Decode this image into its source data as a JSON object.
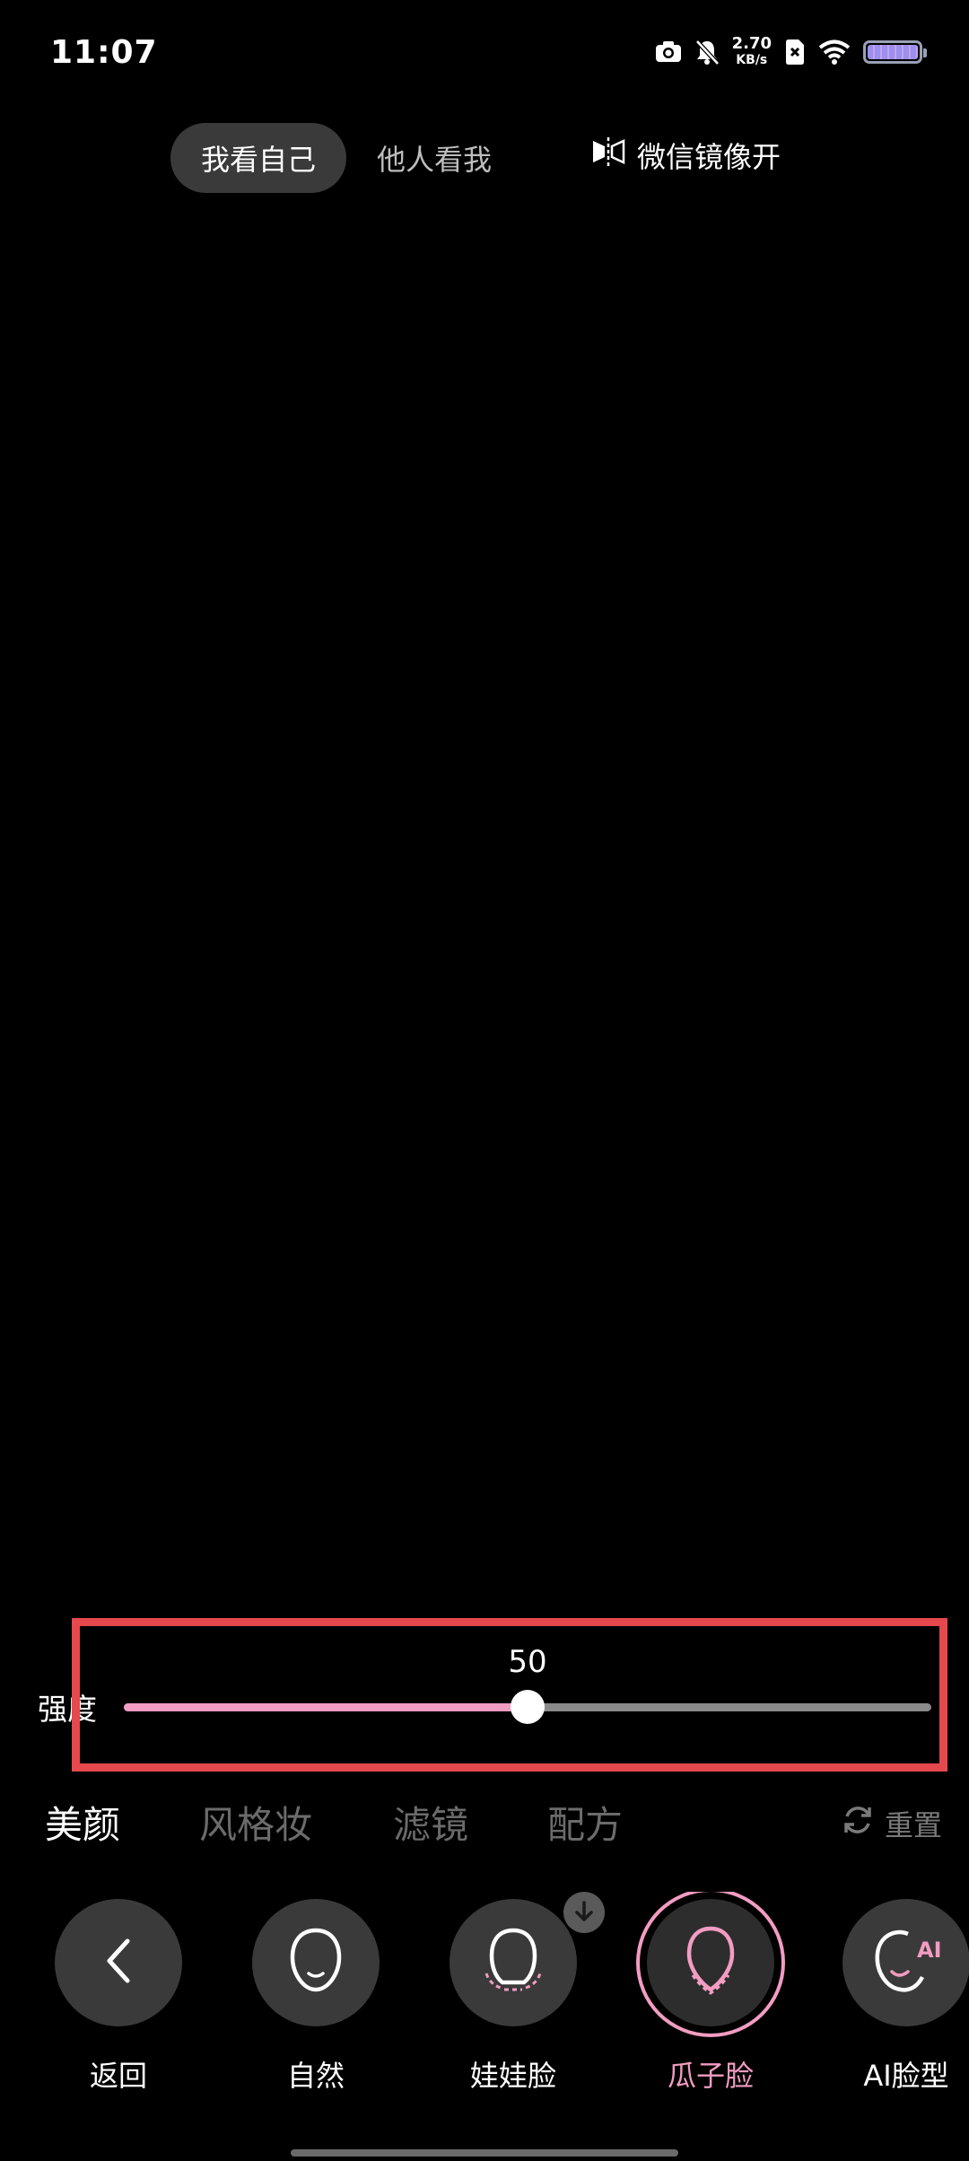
{
  "status_bar": {
    "time": "11:07",
    "net_speed": "2.70",
    "net_unit": "KB/s",
    "icons": [
      "camera-icon",
      "mute-icon",
      "net-speed",
      "sim-x-icon",
      "wifi-icon",
      "battery-icon"
    ]
  },
  "view_toggle": {
    "self_view": "我看自己",
    "others_view": "他人看我"
  },
  "mirror_label": "微信镜像开",
  "slider": {
    "label": "强度",
    "value": "50",
    "fraction": 0.5,
    "fill_color": "#f29cc1"
  },
  "tabs": [
    {
      "label": "美颜",
      "active": true
    },
    {
      "label": "风格妆",
      "active": false
    },
    {
      "label": "滤镜",
      "active": false
    },
    {
      "label": "配方",
      "active": false
    }
  ],
  "reset_label": "重置",
  "items": [
    {
      "label": "返回",
      "icon": "back-chevron-icon"
    },
    {
      "label": "自然",
      "icon": "face-natural-icon"
    },
    {
      "label": "娃娃脸",
      "icon": "face-baby-icon",
      "download": true
    },
    {
      "label": "瓜子脸",
      "icon": "face-vshape-icon",
      "selected": true
    },
    {
      "label": "AI脸型",
      "icon": "face-ai-icon",
      "badge_text": "AI"
    }
  ],
  "accent_color": "#f29cc1"
}
